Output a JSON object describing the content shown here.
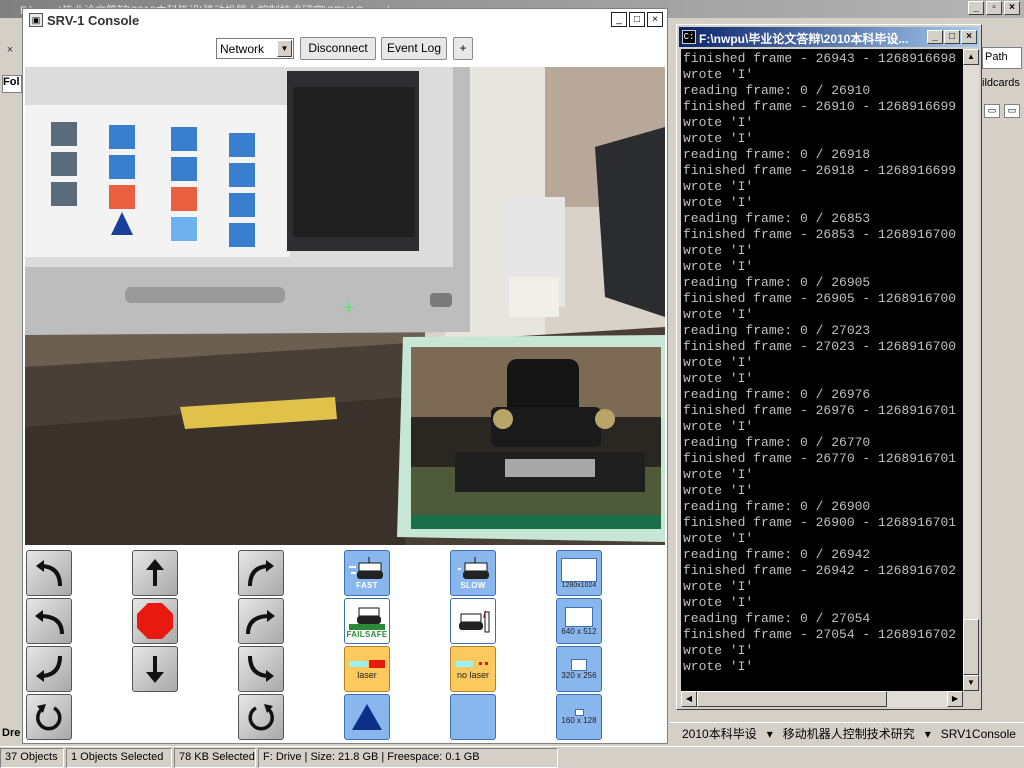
{
  "explorer": {
    "title": "F:\\nwpu\\毕业论文答辩\\2010本科毕设\\移动机器人控制技术研究\\SRV1Console",
    "left_panel_close": "×",
    "left_panel_label": "Fol",
    "left_bottom_label": "Dre",
    "right_path_label": "Path",
    "right_wildcards_label": "ildcards",
    "path_segments": [
      "2010本科毕设",
      "移动机器人控制技术研究",
      "SRV1Console"
    ],
    "status": {
      "objects": "37 Objects",
      "selected": "1 Objects Selected",
      "size_selected": "78 KB Selected",
      "drive": "F: Drive | Size: 21.8 GB | Freespace: 0.1 GB"
    }
  },
  "srv_console": {
    "title": "SRV-1 Console",
    "toolbar": {
      "network_select_value": "Network",
      "disconnect_label": "Disconnect",
      "event_log_label": "Event Log",
      "plus_label": "+"
    },
    "buttons": {
      "fast_label": "FAST",
      "slow_label": "SLOW",
      "failsafe_label": "FAILSAFE",
      "laser_label": "laser",
      "no_laser_label": "no laser",
      "res_1280": "1280x1024",
      "res_640": "640 x 512",
      "res_320": "320 x 256",
      "res_160": "160 x 128"
    }
  },
  "console": {
    "title": "F:\\nwpu\\毕业论文答辩\\2010本科毕设...",
    "lines": [
      "finished frame - 26943 - 1268916698",
      "wrote 'I'",
      "reading frame: 0 / 26910",
      "finished frame - 26910 - 1268916699",
      "wrote 'I'",
      "wrote 'I'",
      "reading frame: 0 / 26918",
      "finished frame - 26918 - 1268916699",
      "wrote 'I'",
      "wrote 'I'",
      "reading frame: 0 / 26853",
      "finished frame - 26853 - 1268916700",
      "wrote 'I'",
      "wrote 'I'",
      "reading frame: 0 / 26905",
      "finished frame - 26905 - 1268916700",
      "wrote 'I'",
      "reading frame: 0 / 27023",
      "finished frame - 27023 - 1268916700",
      "wrote 'I'",
      "wrote 'I'",
      "reading frame: 0 / 26976",
      "finished frame - 26976 - 1268916701",
      "wrote 'I'",
      "reading frame: 0 / 26770",
      "finished frame - 26770 - 1268916701",
      "wrote 'I'",
      "wrote 'I'",
      "reading frame: 0 / 26900",
      "finished frame - 26900 - 1268916701",
      "wrote 'I'",
      "reading frame: 0 / 26942",
      "finished frame - 26942 - 1268916702",
      "wrote 'I'",
      "wrote 'I'",
      "reading frame: 0 / 27054",
      "finished frame - 27054 - 1268916702",
      "wrote 'I'",
      "wrote 'I'"
    ]
  },
  "colors": {
    "console_bg": "#000000",
    "console_text": "#c0c0c0",
    "active_title": "#0a246a",
    "button_blue": "#8ab6ee",
    "button_orange": "#fbc95e",
    "stop_red": "#e8190e"
  }
}
